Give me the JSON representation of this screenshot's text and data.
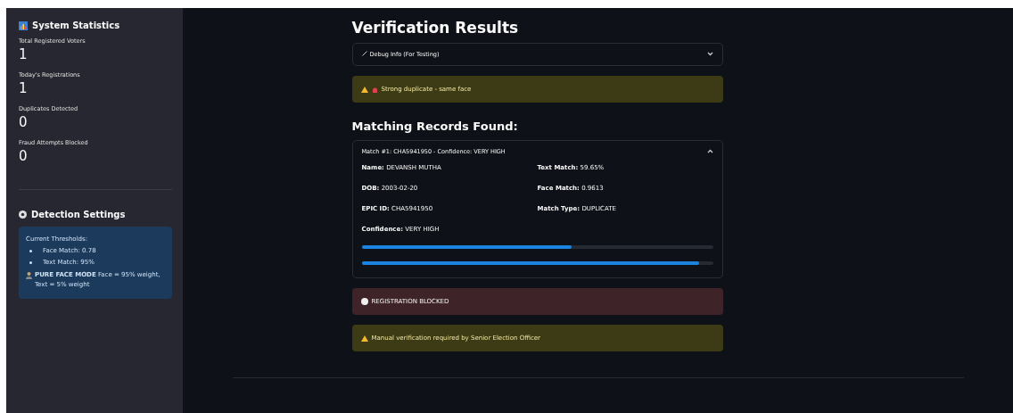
{
  "sidebar": {
    "stats_title": "System Statistics",
    "stats": [
      {
        "label": "Total Registered Voters",
        "value": "1"
      },
      {
        "label": "Today's Registrations",
        "value": "1"
      },
      {
        "label": "Duplicates Detected",
        "value": "0"
      },
      {
        "label": "Fraud Attempts Blocked",
        "value": "0"
      }
    ],
    "settings_title": "Detection Settings",
    "thresholds": {
      "heading": "Current Thresholds:",
      "items": [
        "Face Match: 0.78",
        "Text Match: 95%"
      ],
      "note": "**PURE FACE MODE** Face = 95% weight, Text = 5% weight"
    }
  },
  "main": {
    "title": "Verification Results",
    "debug": {
      "label": "Debug Info (For Testing)",
      "expanded": false
    },
    "alerts_top": [
      {
        "kind": "duplicate",
        "text": "Strong duplicate - same face"
      }
    ],
    "matches_heading": "Matching Records Found:",
    "match": {
      "label": "Match #1: CHA5941950 - Confidence: VERY HIGH",
      "expanded": true,
      "fields": [
        "**Name:** DEVANSH MUTHA",
        "**Text Match:** 59.65%",
        "**DOB:** 2003-02-20",
        "**Face Match:** 0.9613",
        "**EPIC ID:** CHA5941950",
        "**Match Type:** DUPLICATE",
        "**Confidence:** VERY HIGH"
      ],
      "bars": [
        {
          "level": 0.5965
        },
        {
          "level": 0.9613
        }
      ]
    },
    "alerts_bottom": [
      {
        "kind": "error",
        "text": "REGISTRATION BLOCKED"
      },
      {
        "kind": "warning",
        "text": "Manual verification required by Senior Election Officer"
      }
    ]
  }
}
